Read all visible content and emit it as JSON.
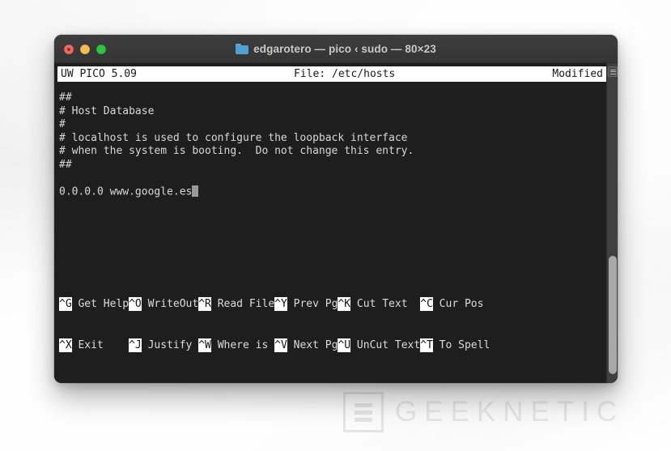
{
  "window": {
    "title": "edgarotero — pico ‹ sudo — 80×23",
    "folder_icon": "folder-icon",
    "traffic_lights": [
      {
        "name": "close-button",
        "color": "#ee6a5f"
      },
      {
        "name": "minimize-button",
        "color": "#f5bd4f"
      },
      {
        "name": "maximize-button",
        "color": "#2fc440"
      }
    ]
  },
  "editor": {
    "status_left": "UW PICO 5.09",
    "status_center": "File: /etc/hosts",
    "status_right": "Modified",
    "lines": [
      "##",
      "# Host Database",
      "#",
      "# localhost is used to configure the loopback interface",
      "# when the system is booting.  Do not change this entry.",
      "##",
      "",
      "0.0.0.0 www.google.es"
    ],
    "cursor_line_index": 7,
    "shortcuts_row1": [
      {
        "key": "^G",
        "label": " Get Help"
      },
      {
        "key": "^O",
        "label": " WriteOut"
      },
      {
        "key": "^R",
        "label": " Read File"
      },
      {
        "key": "^Y",
        "label": " Prev Pg"
      },
      {
        "key": "^K",
        "label": " Cut Text"
      },
      {
        "key": "^C",
        "label": " Cur Pos"
      }
    ],
    "shortcuts_row2": [
      {
        "key": "^X",
        "label": " Exit"
      },
      {
        "key": "^J",
        "label": " Justify"
      },
      {
        "key": "^W",
        "label": " Where is"
      },
      {
        "key": "^V",
        "label": " Next Pg"
      },
      {
        "key": "^U",
        "label": " UnCut Text"
      },
      {
        "key": "^T",
        "label": " To Spell"
      }
    ]
  },
  "watermark": {
    "text": "GEEKNETIC"
  },
  "colors": {
    "terminal_bg": "#1e1e1e",
    "chrome_bg": "#3a3a3a",
    "status_bg": "#ffffff",
    "text": "#d8d8d8",
    "cursor": "#9a9a9a",
    "folder_blue": "#4ea3d2"
  }
}
